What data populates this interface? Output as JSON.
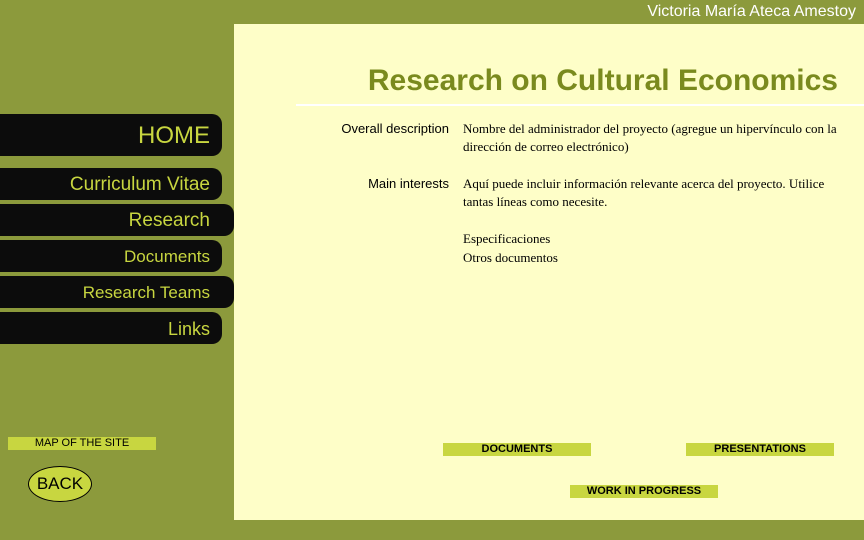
{
  "header": {
    "author": "Victoria María Ateca Amestoy"
  },
  "page": {
    "title": "Research on Cultural Economics"
  },
  "nav": {
    "home": "HOME",
    "cv": "Curriculum Vitae",
    "research": "Research",
    "documents": "Documents",
    "teams": "Research Teams",
    "links": "Links"
  },
  "sidebar": {
    "map": "MAP OF THE SITE",
    "back": "BACK"
  },
  "content": {
    "overall_label": "Overall description",
    "overall_value": "Nombre del administrador del proyecto (agregue un hipervínculo con la dirección de correo electrónico)",
    "interests_label": "Main interests",
    "interests_value": "Aquí puede incluir información relevante acerca del proyecto. Utilice tantas líneas como necesite.",
    "spec": "Especificaciones",
    "other_docs": "Otros documentos"
  },
  "footer_links": {
    "documents": "DOCUMENTS",
    "presentations": "PRESENTATIONS",
    "wip": "WORK IN PROGRESS"
  },
  "colors": {
    "olive": "#8c9a3c",
    "cream": "#fefec8",
    "lime": "#c8d640",
    "title": "#7a8a1e",
    "nav_bg": "#0c0c0c"
  }
}
